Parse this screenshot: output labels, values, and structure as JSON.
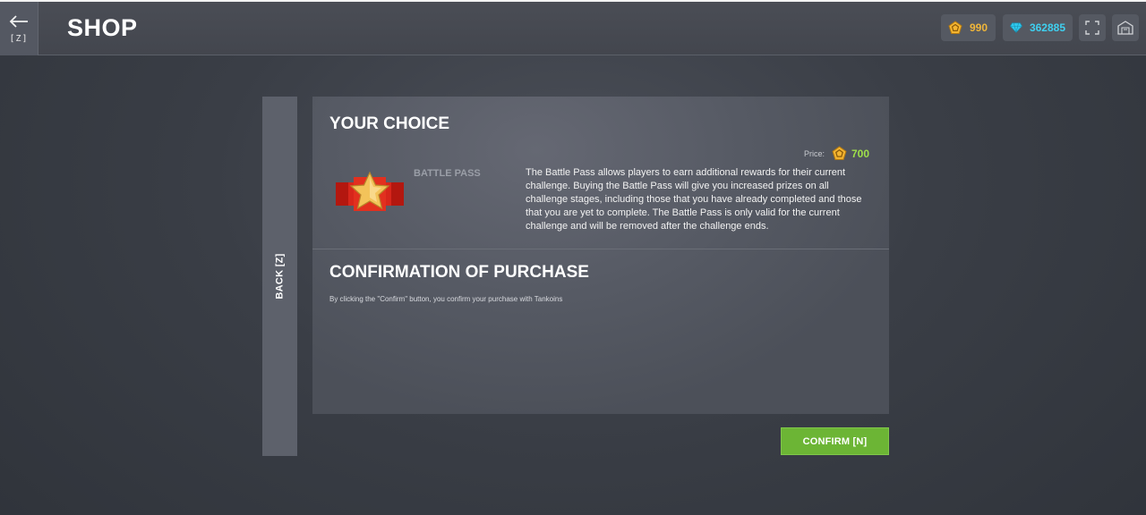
{
  "header": {
    "back_key": "[Z]",
    "title": "SHOP",
    "crystals": "990",
    "tankoins": "362885"
  },
  "side": {
    "back_label": "BACK [Z]"
  },
  "choice": {
    "title": "YOUR CHOICE",
    "price_label": "Price:",
    "price_value": "700",
    "item_name": "BATTLE PASS",
    "item_description": "The Battle Pass allows players to earn additional rewards for their current challenge. Buying the Battle Pass will give you increased prizes on all challenge stages, including those that you have already completed and those that you are yet to complete. The Battle Pass is only valid for the current challenge and will be removed after the challenge ends."
  },
  "confirmation": {
    "title": "CONFIRMATION OF PURCHASE",
    "text": "By clicking the \"Confirm\" button, you confirm your purchase with Tankoins"
  },
  "actions": {
    "confirm_label": "CONFIRM [N]"
  },
  "icons": {
    "back": "left-arrow-icon",
    "crystals": "pentagon-coin-icon",
    "tankoins": "diamond-icon",
    "fullscreen": "fullscreen-icon",
    "home": "garage-icon",
    "item": "battle-pass-star-icon"
  },
  "colors": {
    "gold": "#f0b63a",
    "cyan": "#3fd0f0",
    "price_green": "#9fe04a",
    "confirm_green": "#6cb535"
  }
}
